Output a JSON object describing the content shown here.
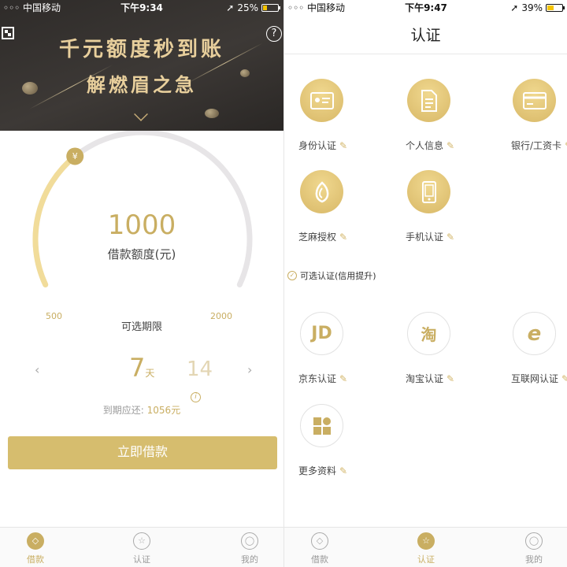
{
  "left": {
    "status": {
      "carrier": "◦◦◦ 中国移动",
      "time": "下午9:34",
      "battery": "25%"
    },
    "banner": {
      "line1": "千元额度秒到账",
      "line2": "解燃眉之急"
    },
    "gauge": {
      "amount": "1000",
      "amount_label": "借款额度(元)",
      "min": "500",
      "max": "2000",
      "yen_icon": "¥",
      "fill_fraction": 0.33
    },
    "term": {
      "title": "可选期限",
      "selected_num": "7",
      "selected_unit": "天",
      "other": "14",
      "prev": "‹",
      "next": "›"
    },
    "due": {
      "label": "到期应还:",
      "value": "1056元"
    },
    "borrow_button": "立即借款",
    "tabs": [
      {
        "label": "借款",
        "icon": "◇"
      },
      {
        "label": "认证",
        "icon": "☆"
      },
      {
        "label": "我的",
        "icon": "◯"
      }
    ]
  },
  "right": {
    "status": {
      "carrier": "◦◦◦ 中国移动",
      "time": "下午9:47",
      "battery": "39%"
    },
    "title": "认证",
    "required": [
      {
        "label": "身份认证",
        "icon": "id-card-icon"
      },
      {
        "label": "个人信息",
        "icon": "document-icon"
      },
      {
        "label": "银行/工资卡",
        "icon": "bank-card-icon"
      },
      {
        "label": "芝麻授权",
        "icon": "sesame-icon"
      },
      {
        "label": "手机认证",
        "icon": "phone-icon"
      }
    ],
    "optional_label": "可选认证(信用提升)",
    "optional": [
      {
        "label": "京东认证",
        "glyph": "JD"
      },
      {
        "label": "淘宝认证",
        "glyph": "淘"
      },
      {
        "label": "互联网认证",
        "glyph": "e"
      },
      {
        "label": "更多资料",
        "glyph": ""
      }
    ],
    "tabs": [
      {
        "label": "借款",
        "icon": "◇"
      },
      {
        "label": "认证",
        "icon": "☆"
      },
      {
        "label": "我的",
        "icon": "◯"
      }
    ]
  },
  "colors": {
    "gold": "#c9ae62",
    "button": "#d6bd6e",
    "banner": "#3a3633"
  }
}
